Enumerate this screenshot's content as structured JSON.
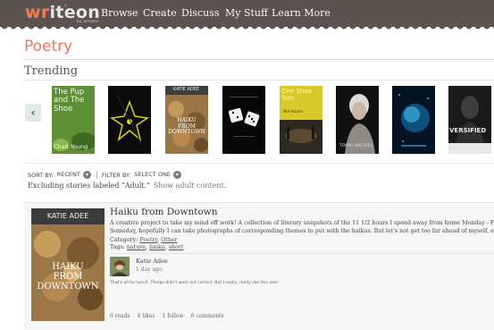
{
  "header": {
    "logo_prefix": "wr",
    "logo_suffix": "iteon",
    "logo_small_top": "a",
    "logo_small_bottom": "by amazon",
    "nav": [
      "Browse",
      "Create",
      "Discuss",
      "My Stuff",
      "Learn More"
    ]
  },
  "page": {
    "title": "Poetry",
    "trending_heading": "Trending",
    "prev_glyph": "‹"
  },
  "books": [
    {
      "title_lines": [
        "The Pup",
        "and The",
        "Shoe"
      ],
      "author": "Chad Young"
    },
    {
      "title_lines": [],
      "author": ""
    },
    {
      "title_lines": [
        "HAIKU",
        "FROM",
        "DOWNTOWN"
      ],
      "author": "KATIE ADEE"
    },
    {
      "title_lines": [],
      "author": ""
    },
    {
      "title_lines": [
        "One Shoe",
        "Tom"
      ],
      "author": "Wd Koshe"
    },
    {
      "title_lines": [],
      "author": "TONYA WALTERS"
    },
    {
      "title_lines": [],
      "author": ""
    },
    {
      "title_lines": [
        "VERSIFIED"
      ],
      "author": ""
    }
  ],
  "filters": {
    "sort_label": "SORT BY:",
    "sort_value": "RECENT",
    "filter_label": "FILTER BY:",
    "filter_value": "SELECT ONE",
    "caret": "▾",
    "exclude_text": "Excluding stories labeled \"Adult.\"",
    "show_adult_link": "Show adult content."
  },
  "story": {
    "cover_author": "KATIE ADEE",
    "cover_title_lines": [
      "HAIKU",
      "FROM",
      "DOWNTOWN"
    ],
    "title": "Haiku from Downtown",
    "description_lines": [
      "A creative project to take my mind off work! A collection of literary snapshots of the 11 1/2 hours I spend away from home Monday - Fr",
      "Someday, hopefully I can take photographs of corresponding themes to put with the haikus. But let's not get too far ahead of myself, e"
    ],
    "category_label": "Category:",
    "categories": [
      "Poetry",
      "Other"
    ],
    "tags_label": "Tags:",
    "tags": [
      "nature",
      "haiku",
      "short"
    ],
    "comment": {
      "author": "Katie Adee",
      "time": "1 day ago",
      "text": "That's all for lunch. Things didn't work out correct. But I really, really like this one!"
    },
    "stats": {
      "reads": "6 reads",
      "likes": "4 likes",
      "follow": "1 follow",
      "comments": "6 comments"
    }
  },
  "colors": {
    "header_bg": "#5a5350",
    "accent": "#e9765b"
  }
}
